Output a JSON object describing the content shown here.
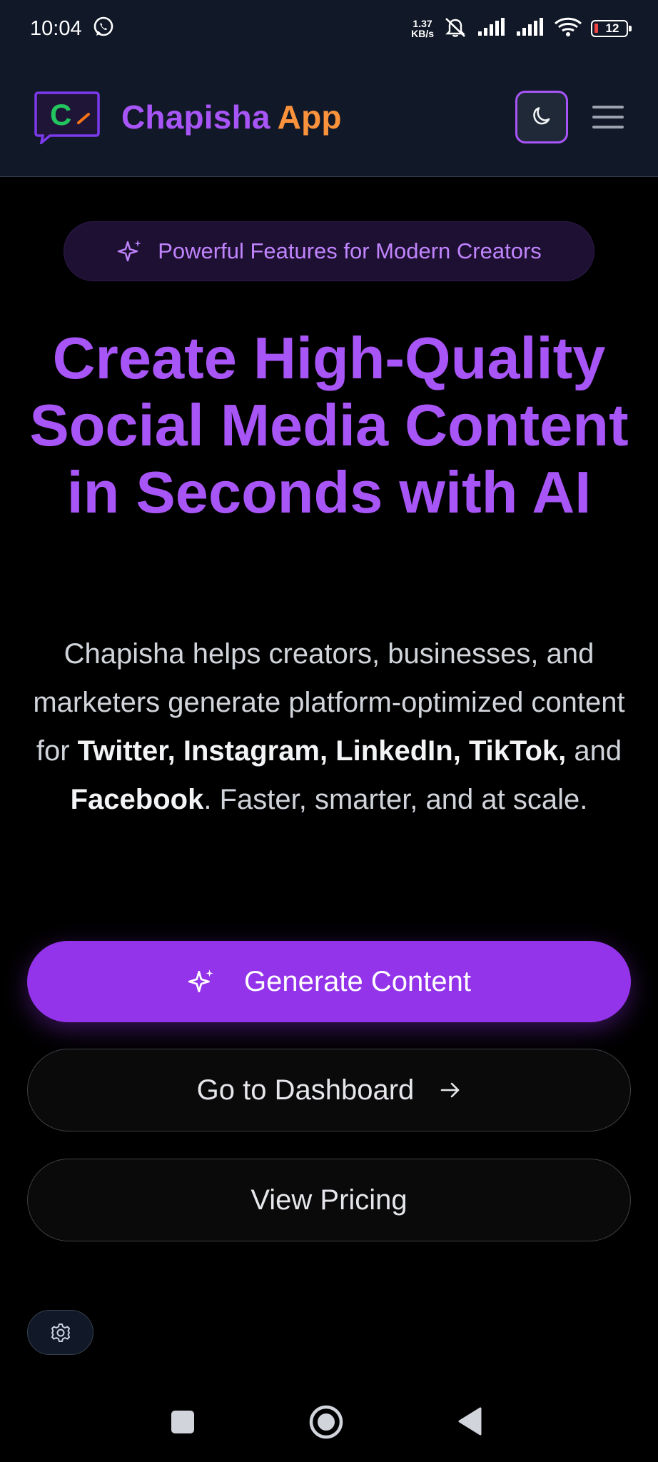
{
  "status_bar": {
    "time": "10:04",
    "net_speed_value": "1.37",
    "net_speed_unit": "KB/s",
    "battery": "12"
  },
  "header": {
    "logo_letter": "C",
    "brand_first": "Chapisha",
    "brand_second": "App"
  },
  "hero": {
    "badge": "Powerful Features for Modern Creators",
    "title": "Create High-Quality Social Media Content in Seconds with AI",
    "desc_parts": {
      "p1": "Chapisha helps creators, businesses, and marketers generate platform-optimized content for ",
      "twitter": "Twitter,",
      "instagram": "Instagram,",
      "linkedin": "LinkedIn,",
      "tiktok": "TikTok,",
      "and": " and ",
      "facebook": "Facebook",
      "p2": ". Faster, smarter, and at scale."
    }
  },
  "buttons": {
    "generate": "Generate Content",
    "dashboard": "Go to Dashboard",
    "pricing": "View Pricing"
  },
  "colors": {
    "accent": "#a855f7",
    "primary_button": "#9333ea",
    "brand_secondary": "#fb923c",
    "header_bg": "#111827"
  },
  "icons": {
    "whatsapp": "whatsapp-icon",
    "mute": "mute-icon",
    "signal": "signal-icon",
    "wifi": "wifi-icon",
    "theme": "moon-icon",
    "menu": "hamburger-menu-icon",
    "sparkle": "sparkle-icon",
    "arrow": "arrow-right-icon",
    "settings": "gear-icon",
    "nav_recents": "square-icon",
    "nav_home": "circle-icon",
    "nav_back": "triangle-back-icon"
  }
}
